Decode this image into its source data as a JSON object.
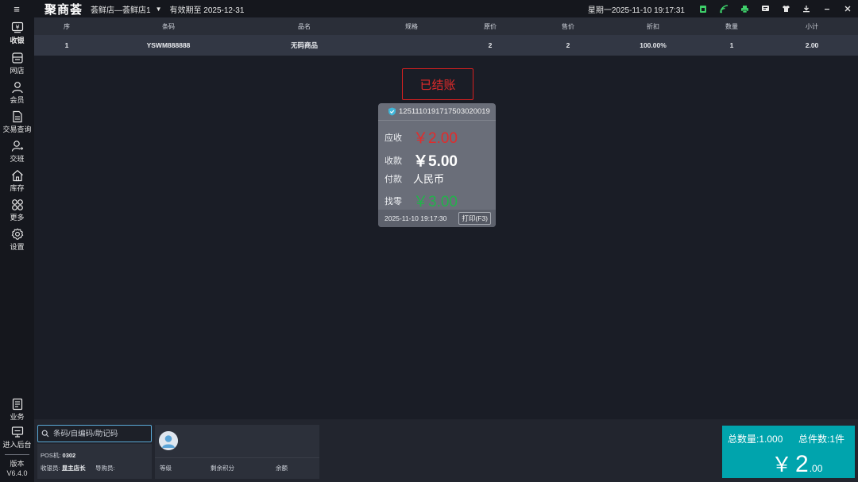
{
  "topbar": {
    "logo": "聚商荟",
    "store": "荟鲜店—荟鲜店1",
    "expire": "有效期至 2025-12-31",
    "datetime": "星期一2025-11-10 19:17:31"
  },
  "sidebar": {
    "items": [
      {
        "label": "收银",
        "icon": "cashier-icon"
      },
      {
        "label": "网店",
        "icon": "store-icon"
      },
      {
        "label": "会员",
        "icon": "member-icon"
      },
      {
        "label": "交易查询",
        "icon": "transaction-icon"
      },
      {
        "label": "交班",
        "icon": "shift-icon"
      },
      {
        "label": "库存",
        "icon": "inventory-icon"
      },
      {
        "label": "更多",
        "icon": "more-icon"
      },
      {
        "label": "设置",
        "icon": "settings-icon"
      },
      {
        "label": "业务",
        "icon": "business-icon"
      },
      {
        "label": "进入后台",
        "icon": "backend-icon"
      }
    ],
    "version_label": "版本",
    "version": "V6.4.0"
  },
  "table": {
    "columns": [
      "序",
      "条码",
      "品名",
      "规格",
      "原价",
      "售价",
      "折扣",
      "数量",
      "小计"
    ],
    "rows": [
      [
        "1",
        "YSWM888888",
        "无码商品",
        "",
        "2",
        "2",
        "100.00%",
        "1",
        "2.00"
      ]
    ]
  },
  "receipt": {
    "stamp": "已结账",
    "order_no": "1251110191717503020019",
    "due_label": "应收",
    "due": "￥2.00",
    "received_label": "收款",
    "received": "￥5.00",
    "pay_label": "付款",
    "pay_method": "人民币",
    "change_label": "找零",
    "change": "￥3.00",
    "time": "2025-11-10 19:17:30",
    "print_button": "打印(F3)"
  },
  "bottom": {
    "search_placeholder": "条码/自编码/助记码",
    "pos_label": "POS机:",
    "pos_value": "0302",
    "cashier_label": "收银员:",
    "cashier_value": "显主店长",
    "guide_label": "导购员:",
    "member_level": "等级",
    "member_points": "剩余积分",
    "member_balance": "余额"
  },
  "total": {
    "qty": "总数量:1.000",
    "count": "总件数:1件",
    "currency": "￥",
    "integer": "2",
    "decimal": ".00"
  },
  "colors": {
    "accent": "#00a4ad",
    "stamp_red": "#e02a2a",
    "due_red": "#e32b2b",
    "change_green": "#23b24b"
  }
}
